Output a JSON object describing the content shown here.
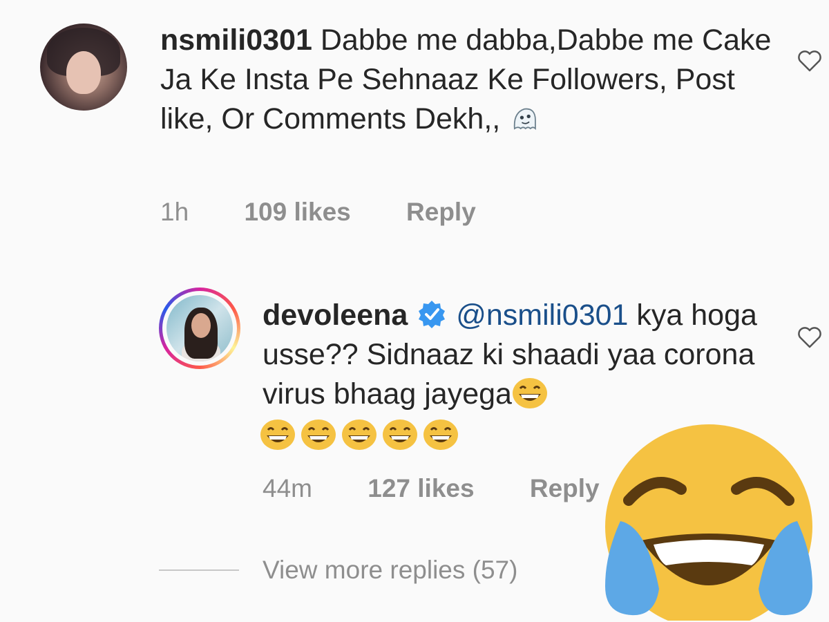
{
  "comments": [
    {
      "username": "nsmili0301",
      "text": " Dabbe me dabba,Dabbe me Cake Ja Ke Insta Pe Sehnaaz Ke Followers, Post like, Or Comments Dekh,, ",
      "time": "1h",
      "likes": "109 likes",
      "reply": "Reply",
      "emoji_icon": "ghost-emoji"
    },
    {
      "username": "devoleena",
      "verified_icon": "verified-badge-icon",
      "mention": "@nsmili0301",
      "text": " kya hoga usse?? Sidnaaz ki shaadi yaa corona virus bhaag jayega",
      "time": "44m",
      "likes": "127 likes",
      "reply": "Reply",
      "emoji_icon": "laughing-emoji",
      "emoji_count": 6
    }
  ],
  "view_more": "View more replies (57)",
  "overlay_icon": "face-with-tears-of-joy-emoji",
  "colors": {
    "background": "#fafafa",
    "text": "#262626",
    "meta": "#8e8e8e",
    "mention": "#1a4f8a",
    "verified": "#3897f0",
    "emoji_yellow": "#f5c242",
    "tears": "#5da8e6"
  }
}
